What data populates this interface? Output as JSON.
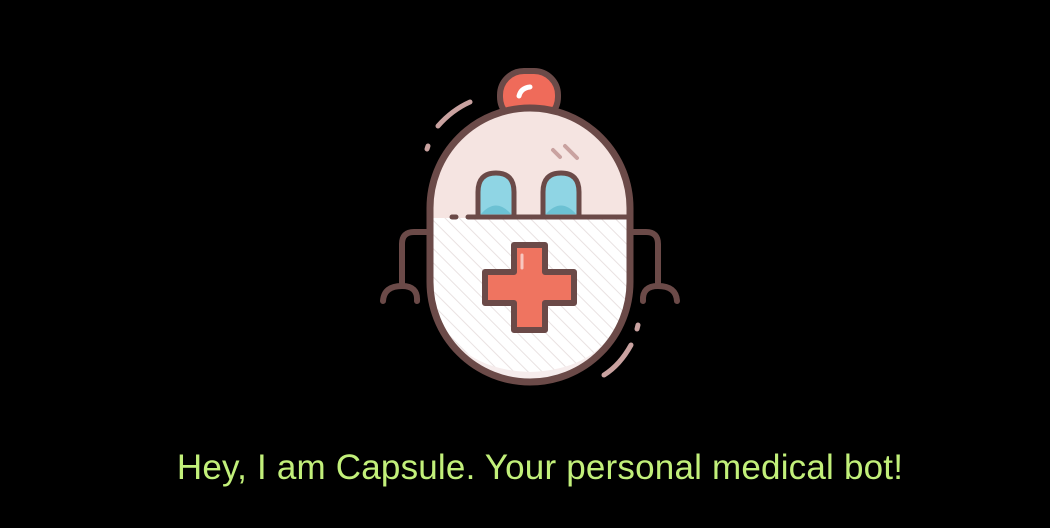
{
  "message": {
    "text": "Hey, I am Capsule. Your personal medical bot!"
  },
  "mascot": {
    "icon": "capsule-robot-icon",
    "colors": {
      "outline": "#6b4a48",
      "body_top": "#f5e4e1",
      "body_bottom": "#ffffff",
      "cap": "#ef6b5a",
      "cross": "#ef7460",
      "eyes": "#8fd5e4",
      "background": "#000000",
      "text": "#c2f07a"
    }
  }
}
